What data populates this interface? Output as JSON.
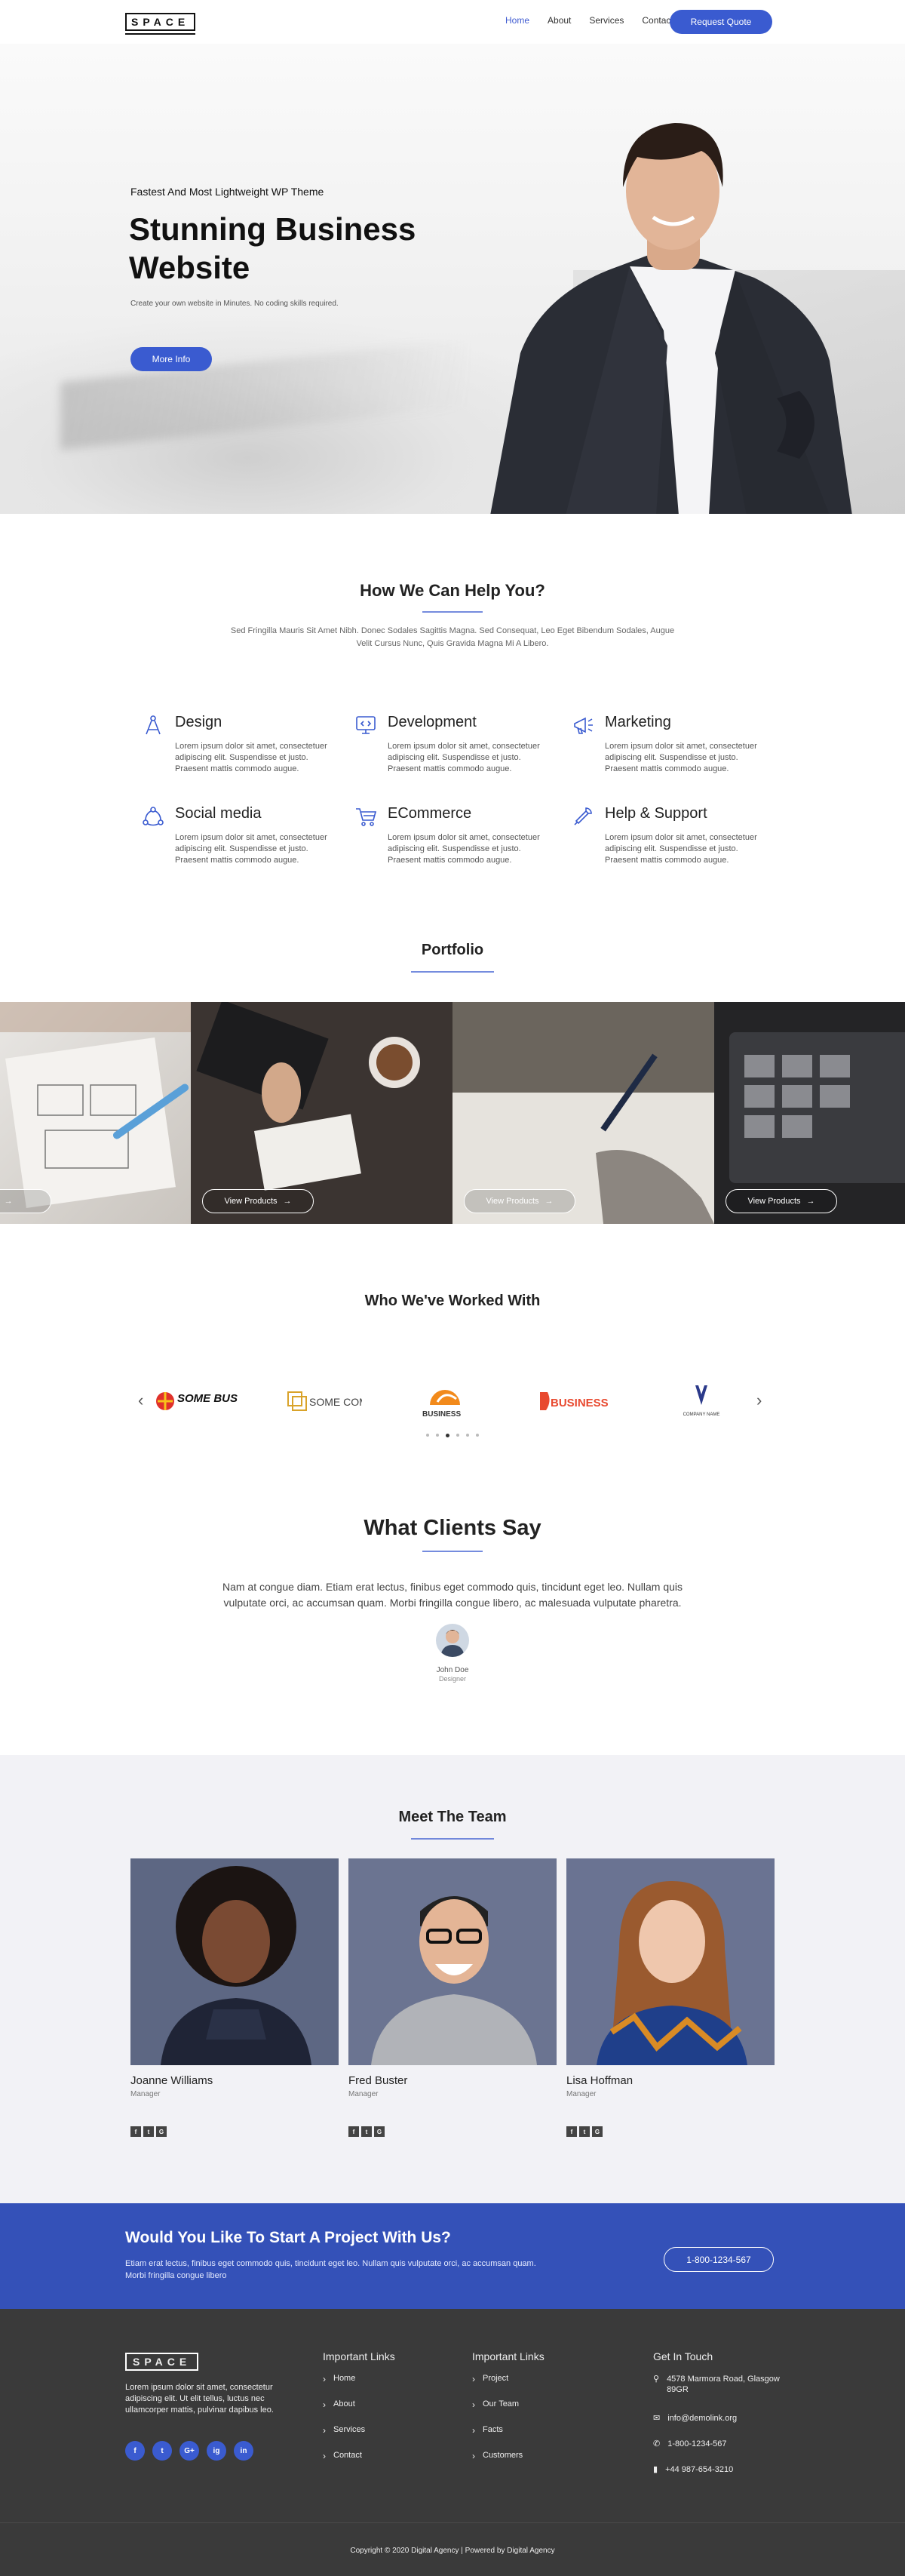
{
  "header": {
    "logo": "SPACE",
    "nav": [
      "Home",
      "About",
      "Services",
      "Contact"
    ],
    "cta": "Request Quote"
  },
  "hero": {
    "subtitle": "Fastest And Most Lightweight WP Theme",
    "title_line1": "Stunning Business",
    "title_line2": "Website",
    "description": "Create your own website in Minutes. No coding skills required.",
    "button": "More Info"
  },
  "help": {
    "title": "How We Can Help You?",
    "text": "Sed Fringilla Mauris Sit Amet Nibh. Donec Sodales Sagittis Magna. Sed Consequat, Leo Eget Bibendum Sodales, Augue Velit Cursus Nunc, Quis Gravida Magna Mi A Libero.",
    "services": [
      {
        "title": "Design",
        "icon": "compass-icon",
        "text": "Lorem ipsum dolor sit amet, consectetuer adipiscing elit. Suspendisse et justo. Praesent mattis commodo augue."
      },
      {
        "title": "Development",
        "icon": "code-icon",
        "text": "Lorem ipsum dolor sit amet, consectetuer adipiscing elit. Suspendisse et justo. Praesent mattis commodo augue."
      },
      {
        "title": "Marketing",
        "icon": "megaphone-icon",
        "text": "Lorem ipsum dolor sit amet, consectetuer adipiscing elit. Suspendisse et justo. Praesent mattis commodo augue."
      },
      {
        "title": "Social media",
        "icon": "network-icon",
        "text": "Lorem ipsum dolor sit amet, consectetuer adipiscing elit. Suspendisse et justo. Praesent mattis commodo augue."
      },
      {
        "title": "ECommerce",
        "icon": "cart-icon",
        "text": "Lorem ipsum dolor sit amet, consectetuer adipiscing elit. Suspendisse et justo. Praesent mattis commodo augue."
      },
      {
        "title": "Help & Support",
        "icon": "support-icon",
        "text": "Lorem ipsum dolor sit amet, consectetuer adipiscing elit. Suspendisse et justo. Praesent mattis commodo augue."
      }
    ]
  },
  "portfolio": {
    "title": "Portfolio",
    "button": "View Products",
    "first_button": "ducts"
  },
  "clients": {
    "title": "Who We've Worked With",
    "logos": [
      "SOME BUSINESS",
      "SOME COMPANY",
      "BUSINESS",
      "BUSINESS",
      "COMPANY NAME"
    ]
  },
  "testimonials": {
    "title": "What Clients Say",
    "quote": "Nam at congue diam. Etiam erat lectus, finibus eget commodo quis, tincidunt eget leo. Nullam quis vulputate orci, ac accumsan quam. Morbi fringilla congue libero, ac malesuada vulputate pharetra.",
    "name": "John Doe",
    "role": "Designer"
  },
  "team": {
    "title": "Meet The Team",
    "members": [
      {
        "name": "Joanne Williams",
        "role": "Manager"
      },
      {
        "name": "Fred Buster",
        "role": "Manager"
      },
      {
        "name": "Lisa Hoffman",
        "role": "Manager"
      }
    ]
  },
  "cta": {
    "title": "Would You Like To Start A Project With Us?",
    "text": "Etiam erat lectus, finibus eget commodo quis, tincidunt eget leo. Nullam quis vulputate orci, ac accumsan quam. Morbi fringilla congue libero",
    "phone": "1-800-1234-567"
  },
  "footer": {
    "logo": "SPACE",
    "about": "Lorem ipsum dolor sit amet, consectetur adipiscing elit. Ut elit tellus, luctus nec ullamcorper mattis, pulvinar dapibus leo.",
    "social": [
      "f",
      "t",
      "G+",
      "ig",
      "in"
    ],
    "links1": {
      "title": "Important Links",
      "items": [
        "Home",
        "About",
        "Services",
        "Contact"
      ]
    },
    "links2": {
      "title": "Important Links",
      "items": [
        "Project",
        "Our Team",
        "Facts",
        "Customers"
      ]
    },
    "touch": {
      "title": "Get In Touch",
      "address": "4578 Marmora Road, Glasgow 89GR",
      "email": "info@demolink.org",
      "phone1": "1-800-1234-567",
      "phone2": "+44 987-654-3210"
    },
    "copyright": "Copyright © 2020 Digital Agency | Powered by Digital Agency"
  }
}
